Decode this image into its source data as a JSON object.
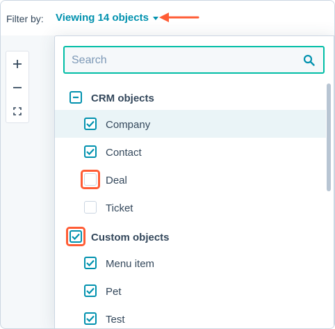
{
  "filter": {
    "label": "Filter by:",
    "toggle_label": "Viewing 14 objects"
  },
  "colors": {
    "accent": "#0091ae",
    "annotation": "#ff5c35",
    "search_border": "#00bda5"
  },
  "zoom": {
    "zoom_in_icon": "plus-icon",
    "zoom_out_icon": "minus-icon",
    "fit_icon": "fit-to-screen-icon"
  },
  "search": {
    "placeholder": "Search",
    "value": ""
  },
  "groups": [
    {
      "label": "CRM objects",
      "state": "indeterminate",
      "items": [
        {
          "label": "Company",
          "checked": true
        },
        {
          "label": "Contact",
          "checked": true
        },
        {
          "label": "Deal",
          "checked": false
        },
        {
          "label": "Ticket",
          "checked": false
        }
      ]
    },
    {
      "label": "Custom objects",
      "state": "checked",
      "items": [
        {
          "label": "Menu item",
          "checked": true
        },
        {
          "label": "Pet",
          "checked": true
        },
        {
          "label": "Test",
          "checked": true
        }
      ]
    }
  ]
}
